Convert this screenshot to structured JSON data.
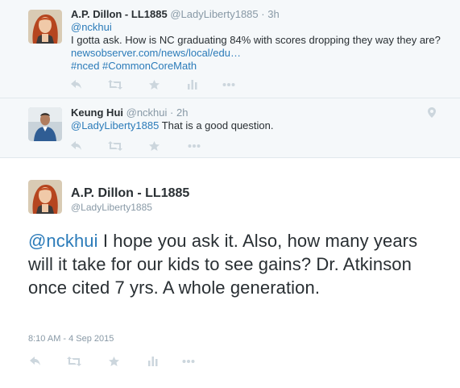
{
  "tweets": [
    {
      "fullname": "A.P. Dillon - LL1885",
      "handle": "@LadyLiberty1885",
      "time": "3h",
      "reply_to": "@nckhui",
      "text": "I gotta ask. How is NC graduating 84% with scores dropping they way they are?",
      "link": "newsobserver.com/news/local/edu…",
      "hashtags": "#nced #CommonCoreMath"
    },
    {
      "fullname": "Keung Hui",
      "handle": "@nckhui",
      "time": "2h",
      "mention": "@LadyLiberty1885",
      "text": "That is a good question."
    }
  ],
  "main_tweet": {
    "fullname": "A.P. Dillon - LL1885",
    "handle": "@LadyLiberty1885",
    "mention": "@nckhui",
    "text": "I hope you ask it. Also, how many years will it take for our kids to see gains? Dr. Atkinson once cited 7 yrs. A whole generation.",
    "timestamp": "8:10 AM - 4 Sep 2015"
  },
  "separator": "·",
  "colors": {
    "link": "#2b7bb9",
    "muted": "#8899a6",
    "icon": "#ccd6dd",
    "context_bg": "#f5f8fa",
    "border": "#e1e8ed"
  },
  "icons": [
    "reply-icon",
    "retweet-icon",
    "favorite-icon",
    "analytics-icon",
    "more-icon",
    "geo-pin-icon"
  ]
}
